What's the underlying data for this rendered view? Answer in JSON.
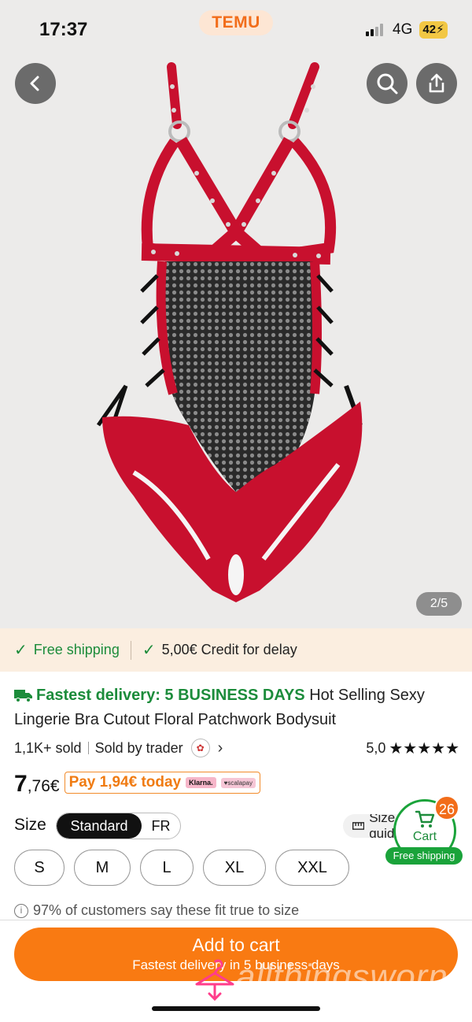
{
  "status": {
    "time": "17:37",
    "network": "4G",
    "battery": "42"
  },
  "brand": "TEMU",
  "gallery": {
    "counter": "2/5"
  },
  "benefits": {
    "shipping": "Free shipping",
    "credit": "5,00€ Credit for delay"
  },
  "product": {
    "delivery_label": "Fastest delivery: 5 BUSINESS DAYS",
    "title": "Hot Selling Sexy Lingerie Bra Cutout Floral Patchwork Bodysuit",
    "sold": "1,1K+ sold",
    "sold_by": "Sold by trader",
    "rating": "5,0",
    "stars": "★★★★★",
    "price_int": "7",
    "price_dec": ",76€",
    "pay_today": "Pay 1,94€ today",
    "klarna": "Klarna.",
    "scalapay": "♥scalapay"
  },
  "size": {
    "label": "Size",
    "toggle": [
      "Standard",
      "FR"
    ],
    "guide": "Size guide",
    "options": [
      "S",
      "M",
      "L",
      "XL",
      "XXL"
    ],
    "fit_note": "97% of customers say these fit true to size"
  },
  "cart": {
    "count": "26",
    "label": "Cart",
    "shipping": "Free shipping"
  },
  "cta": {
    "label": "Add to cart",
    "sub": "Fastest delivery in 5 business days"
  },
  "watermark": "allthingsworn",
  "colors": {
    "accent": "#f97a12",
    "green": "#1c8c3b",
    "red_leather": "#c8102e"
  }
}
